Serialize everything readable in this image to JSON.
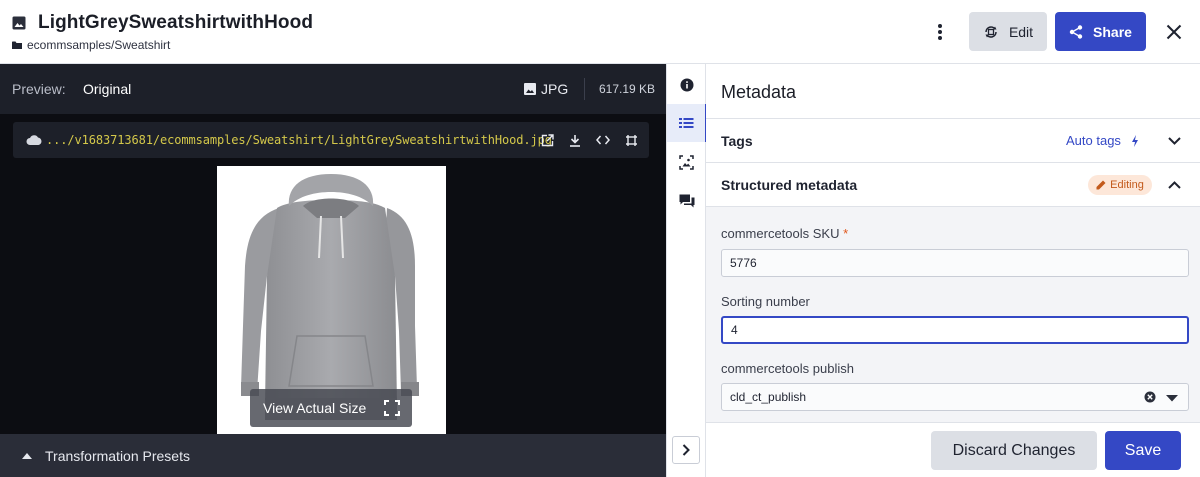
{
  "header": {
    "title": "LightGreySweatshirtwithHood",
    "path": "ecommsamples/Sweatshirt",
    "edit_label": "Edit",
    "share_label": "Share"
  },
  "preview": {
    "label": "Preview:",
    "mode": "Original",
    "format": "JPG",
    "file_size": "617.19 KB",
    "url": ".../v1683713681/ecommsamples/Sweatshirt/LightGreySweatshirtwithHood.jpg",
    "view_actual_label": "View Actual Size",
    "presets_label": "Transformation Presets"
  },
  "metadata": {
    "title": "Metadata",
    "tags_label": "Tags",
    "auto_tags_label": "Auto tags",
    "structured_label": "Structured metadata",
    "editing_label": "Editing",
    "fields": [
      {
        "label": "commercetools SKU",
        "required_mark": "*",
        "value": "5776"
      },
      {
        "label": "Sorting number",
        "value": "4"
      },
      {
        "label": "commercetools publish",
        "value": "cld_ct_publish"
      }
    ],
    "discard_label": "Discard Changes",
    "save_label": "Save"
  },
  "colors": {
    "accent": "#3448c5",
    "url_text": "#d4c84a",
    "editing_badge_bg": "#fde7d9",
    "editing_badge_text": "#c35a1c"
  },
  "icons": [
    "image-icon",
    "folder-icon",
    "more-vertical-icon",
    "edit-transform-icon",
    "share-icon",
    "close-icon",
    "cloud-icon",
    "open-external-icon",
    "download-icon",
    "code-icon",
    "crop-icon",
    "fullscreen-icon",
    "caret-up-icon",
    "info-icon",
    "metadata-list-icon",
    "image-analysis-icon",
    "comments-icon",
    "chevron-right-icon",
    "bolt-icon",
    "chevron-down-icon",
    "chevron-up-icon",
    "pencil-icon",
    "clear-circle-icon",
    "dropdown-caret-icon"
  ]
}
